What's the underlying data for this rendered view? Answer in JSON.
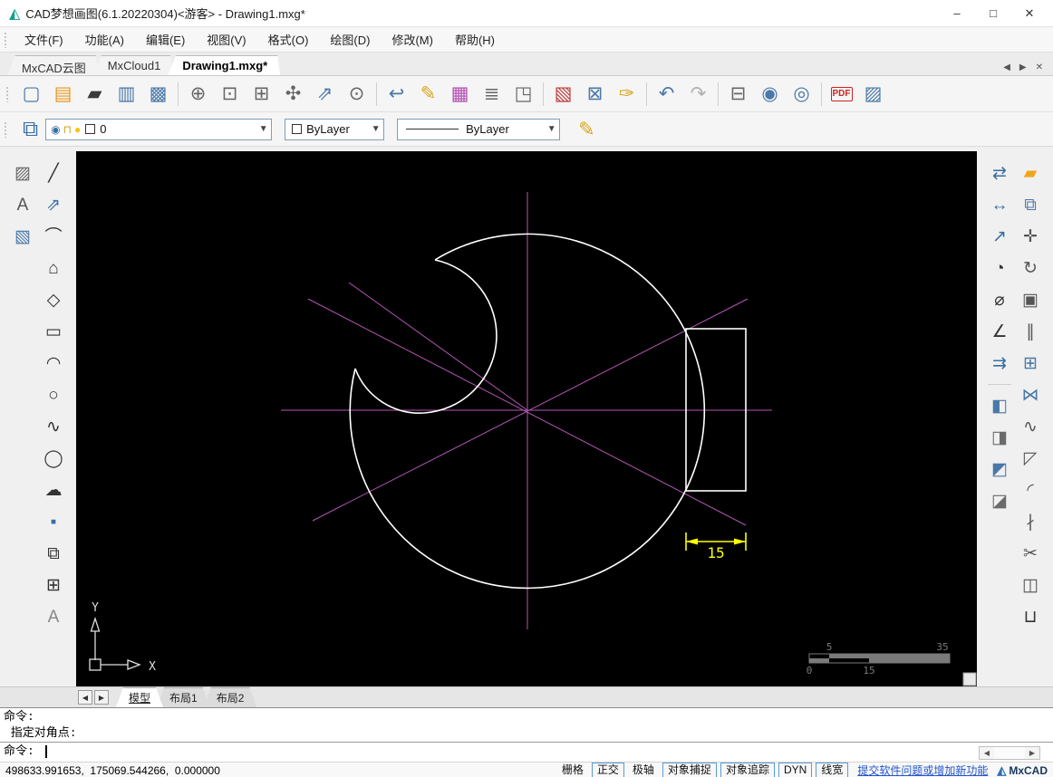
{
  "colors": {
    "construction": "#b456b4",
    "geometry": "#ffffff",
    "dimension": "#ffff00",
    "accent": "#2f6fb5",
    "canvasbg": "#000000"
  },
  "window": {
    "title": "CAD梦想画图(6.1.20220304)<游客>  - Drawing1.mxg*",
    "controls": [
      {
        "name": "minimize-button",
        "glyph": "–"
      },
      {
        "name": "maximize-button",
        "glyph": "□"
      },
      {
        "name": "close-button",
        "glyph": "✕"
      }
    ]
  },
  "menu": {
    "items": [
      {
        "name": "menu-file",
        "label": "文件(F)"
      },
      {
        "name": "menu-function",
        "label": "功能(A)"
      },
      {
        "name": "menu-edit",
        "label": "编辑(E)"
      },
      {
        "name": "menu-view",
        "label": "视图(V)"
      },
      {
        "name": "menu-format",
        "label": "格式(O)"
      },
      {
        "name": "menu-draw",
        "label": "绘图(D)"
      },
      {
        "name": "menu-modify",
        "label": "修改(M)"
      },
      {
        "name": "menu-help",
        "label": "帮助(H)"
      }
    ]
  },
  "doc_tabs": {
    "tabs": [
      {
        "name": "tab-mxcad-cloud",
        "label": "MxCAD云图",
        "active": false
      },
      {
        "name": "tab-mxcloud1",
        "label": "MxCloud1",
        "active": false
      },
      {
        "name": "tab-drawing1",
        "label": "Drawing1.mxg*",
        "active": true
      }
    ],
    "controls": [
      {
        "name": "tab-scroll-left-button",
        "glyph": "◀"
      },
      {
        "name": "tab-scroll-right-button",
        "glyph": "▶"
      },
      {
        "name": "tab-close-button",
        "glyph": "✕"
      }
    ]
  },
  "toolbar": {
    "items": [
      {
        "name": "new-file-button",
        "glyph": "▢",
        "color": "#4a79a8"
      },
      {
        "name": "open-file-button",
        "glyph": "▤",
        "color": "#e8951d"
      },
      {
        "name": "open-folder-button",
        "glyph": "▰",
        "color": "#3a3a3a"
      },
      {
        "name": "save-button",
        "glyph": "▥",
        "color": "#4a79a8"
      },
      {
        "name": "save-as-button",
        "glyph": "▩",
        "color": "#4a79a8"
      },
      {
        "sep": true
      },
      {
        "name": "zoom-dynamic-button",
        "glyph": "⊕",
        "color": "#666666"
      },
      {
        "name": "zoom-window-button",
        "glyph": "⊡",
        "color": "#666666"
      },
      {
        "name": "zoom-extents-button",
        "glyph": "⊞",
        "color": "#666666"
      },
      {
        "name": "pan-button",
        "glyph": "✣",
        "color": "#666666"
      },
      {
        "name": "zoom-scale-button",
        "glyph": "⇗",
        "color": "#4a79a8"
      },
      {
        "name": "zoom-center-button",
        "glyph": "⊙",
        "color": "#666666"
      },
      {
        "sep": true
      },
      {
        "name": "view-previous-button",
        "glyph": "↩",
        "color": "#4a79a8"
      },
      {
        "name": "sketch-button",
        "glyph": "✎",
        "color": "#d9a51b"
      },
      {
        "name": "color-palette-button",
        "glyph": "▦",
        "color": "#b048b0"
      },
      {
        "name": "linetype-manager-button",
        "glyph": "≣",
        "color": "#666666"
      },
      {
        "name": "page-setup-button",
        "glyph": "◳",
        "color": "#666666"
      },
      {
        "sep": true
      },
      {
        "name": "layer-settings-button",
        "glyph": "▧",
        "color": "#c23a3a"
      },
      {
        "name": "quick-select-button",
        "glyph": "⊠",
        "color": "#4a79a8"
      },
      {
        "name": "match-properties-button",
        "glyph": "✑",
        "color": "#d9a51b"
      },
      {
        "sep": true
      },
      {
        "name": "undo-button",
        "glyph": "↶",
        "color": "#4a79a8"
      },
      {
        "name": "redo-button",
        "glyph": "↷",
        "color": "#b0b0b0"
      },
      {
        "sep": true
      },
      {
        "name": "print-button",
        "glyph": "⊟",
        "color": "#666666"
      },
      {
        "name": "web-publish-button",
        "glyph": "◉",
        "color": "#4a79a8"
      },
      {
        "name": "web-upload-button",
        "glyph": "◎",
        "color": "#4a79a8"
      },
      {
        "sep": true
      },
      {
        "name": "pdf-export-button",
        "glyph": "PDF",
        "color": "#cc2222",
        "small": true
      },
      {
        "name": "image-export-button",
        "glyph": "▨",
        "color": "#4a79a8"
      }
    ]
  },
  "properties_bar": {
    "layer_icons": [
      {
        "name": "visibility-icon",
        "glyph": "◉",
        "color": "#3a6ea5"
      },
      {
        "name": "lock-icon",
        "glyph": "⊓",
        "color": "#d4a017"
      },
      {
        "name": "light-icon",
        "glyph": "●",
        "color": "#f5c518"
      }
    ],
    "layer_value": "0",
    "color_value": "ByLayer",
    "linetype_value": "ByLayer"
  },
  "left_toolbar": {
    "col1": [
      {
        "name": "insert-image-button",
        "glyph": "▨",
        "color": "#666666"
      },
      {
        "name": "mtext-button",
        "glyph": "A",
        "color": "#555555"
      },
      {
        "name": "hatch-button",
        "glyph": "▧",
        "color": "#4a79a8"
      }
    ],
    "col2": [
      {
        "name": "line-button",
        "glyph": "╱",
        "color": "#333333"
      },
      {
        "name": "construction-line-button",
        "glyph": "⇗",
        "color": "#3a6ea5"
      },
      {
        "name": "arc-button",
        "glyph": "⌒",
        "color": "#333333"
      },
      {
        "name": "polygon-button",
        "glyph": "⌂",
        "color": "#333333"
      },
      {
        "name": "polyline-button",
        "glyph": "◇",
        "color": "#333333"
      },
      {
        "name": "rectangle-button",
        "glyph": "▭",
        "color": "#333333"
      },
      {
        "name": "arc-3point-button",
        "glyph": "◠",
        "color": "#333333"
      },
      {
        "name": "circle-button",
        "glyph": "○",
        "color": "#333333"
      },
      {
        "name": "spline-button",
        "glyph": "∿",
        "color": "#333333"
      },
      {
        "name": "ellipse-button",
        "glyph": "◯",
        "color": "#333333"
      },
      {
        "name": "revision-cloud-button",
        "glyph": "☁",
        "color": "#333333"
      },
      {
        "name": "point-button",
        "glyph": "▪",
        "color": "#3a6ea5"
      },
      {
        "name": "block-create-button",
        "glyph": "⧉",
        "color": "#333333"
      },
      {
        "name": "block-insert-button",
        "glyph": "⊞",
        "color": "#333333"
      },
      {
        "name": "text-button",
        "glyph": "A",
        "color": "#888888"
      }
    ]
  },
  "right_toolbar": {
    "col1": [
      {
        "name": "dim-continue-button",
        "glyph": "⇄",
        "color": "#3a6ea5"
      },
      {
        "name": "dim-linear-button",
        "glyph": "↔",
        "color": "#3a6ea5"
      },
      {
        "name": "dim-aligned-button",
        "glyph": "↗",
        "color": "#3a6ea5"
      },
      {
        "name": "dim-radius-button",
        "glyph": "◔",
        "color": "#333333"
      },
      {
        "name": "dim-diameter-button",
        "glyph": "⌀",
        "color": "#333333"
      },
      {
        "name": "dim-angular-button",
        "glyph": "∠",
        "color": "#333333"
      },
      {
        "name": "dim-baseline-button",
        "glyph": "⇉",
        "color": "#3a6ea5"
      },
      {
        "sep": true
      },
      {
        "name": "draw-order-front-button",
        "glyph": "◧",
        "color": "#4a79a8"
      },
      {
        "name": "draw-order-back-button",
        "glyph": "◨",
        "color": "#6b6b6b"
      },
      {
        "name": "draw-order-above-button",
        "glyph": "◩",
        "color": "#4a79a8"
      },
      {
        "name": "draw-order-below-button",
        "glyph": "◪",
        "color": "#6b6b6b"
      }
    ],
    "col2": [
      {
        "name": "erase-button",
        "glyph": "▰",
        "color": "#f0a51c"
      },
      {
        "name": "copy-button",
        "glyph": "⧉",
        "color": "#4a79a8"
      },
      {
        "name": "move-button",
        "glyph": "✛",
        "color": "#555555"
      },
      {
        "name": "rotate-button",
        "glyph": "↻",
        "color": "#555555"
      },
      {
        "name": "scale-button",
        "glyph": "▣",
        "color": "#555555"
      },
      {
        "name": "offset-button",
        "glyph": "∥",
        "color": "#555555"
      },
      {
        "name": "array-button",
        "glyph": "⊞",
        "color": "#4a79a8"
      },
      {
        "name": "mirror-button",
        "glyph": "⋈",
        "color": "#4a79a8"
      },
      {
        "name": "spline-fit-button",
        "glyph": "∿",
        "color": "#555555"
      },
      {
        "name": "chamfer-button",
        "glyph": "◸",
        "color": "#555555"
      },
      {
        "name": "fillet-button",
        "glyph": "◜",
        "color": "#555555"
      },
      {
        "name": "break-button",
        "glyph": "∤",
        "color": "#555555"
      },
      {
        "name": "trim-button",
        "glyph": "✂",
        "color": "#555555"
      },
      {
        "name": "box-3d-button",
        "glyph": "◫",
        "color": "#555555"
      },
      {
        "name": "break-point-button",
        "glyph": "⊔",
        "color": "#333333"
      }
    ]
  },
  "canvas": {
    "dimension_label": "15",
    "scale_bar": {
      "top": [
        "5",
        "35"
      ],
      "bottom": [
        "0",
        "15"
      ]
    },
    "ucs": {
      "x": "X",
      "y": "Y"
    }
  },
  "layout_bar": {
    "spinners": [
      {
        "name": "layout-scroll-left-button",
        "glyph": "◀"
      },
      {
        "name": "layout-scroll-right-button",
        "glyph": "▶"
      }
    ],
    "tabs": [
      {
        "name": "tab-model",
        "label": "模型",
        "active": true
      },
      {
        "name": "tab-layout1",
        "label": "布局1",
        "active": false
      },
      {
        "name": "tab-layout2",
        "label": "布局2",
        "active": false
      }
    ]
  },
  "command": {
    "history": [
      {
        "name": "command-history-line",
        "label": "命令:"
      },
      {
        "name": "command-history-line",
        "label": " 指定对角点:"
      }
    ],
    "prompt": "命令: ",
    "scroll": [
      {
        "name": "cmd-scroll-left-button",
        "glyph": "◀"
      },
      {
        "name": "cmd-scroll-right-button",
        "glyph": "▶"
      }
    ]
  },
  "status_bar": {
    "coordinates": "498633.991653,  175069.544266,  0.000000",
    "toggles": [
      {
        "name": "status-toggle-grid",
        "label": "栅格",
        "boxed": false
      },
      {
        "name": "status-toggle-ortho",
        "label": "正交",
        "boxed": true
      },
      {
        "name": "status-toggle-polar",
        "label": "极轴",
        "boxed": false
      },
      {
        "name": "status-toggle-osnap",
        "label": "对象捕捉",
        "boxed": true
      },
      {
        "name": "status-toggle-otrack",
        "label": "对象追踪",
        "boxed": true
      },
      {
        "name": "status-toggle-dyn",
        "label": "DYN",
        "boxed": true
      },
      {
        "name": "status-toggle-lineweight",
        "label": "线宽",
        "boxed": true
      }
    ],
    "link": "提交软件问题或增加新功能",
    "brand": "MxCAD"
  }
}
